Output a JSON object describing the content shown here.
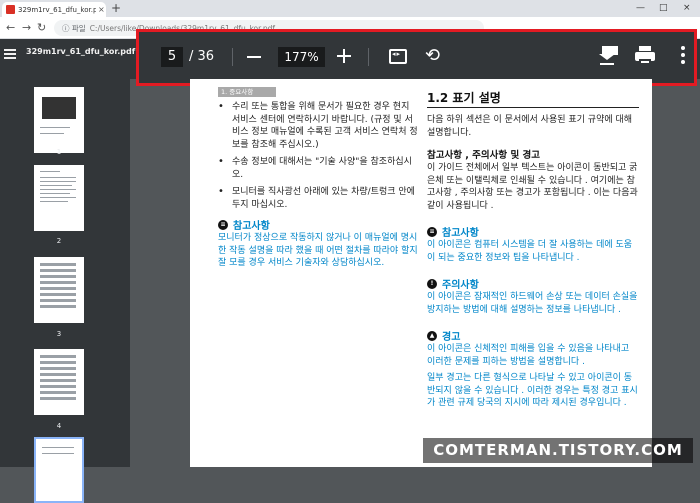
{
  "browser": {
    "tab_title": "329m1rv_61_dfu_kor.pdf",
    "tab_close": "×",
    "new_tab": "+",
    "win_min": "—",
    "win_max": "□",
    "win_close": "×",
    "back": "←",
    "forward": "→",
    "reload": "↻",
    "address_label": "ⓘ 파일",
    "address_path": "C:/Users/like/Downloads/329m1rv_61_dfu_kor.pdf"
  },
  "viewer": {
    "file_name": "329m1rv_61_dfu_kor.pdf",
    "page_current": "5",
    "page_total": "/ 36",
    "zoom": "177%",
    "rotate_icon": "⟲"
  },
  "sidebar": {
    "thumbnails": [
      {
        "label": "1"
      },
      {
        "label": "2"
      },
      {
        "label": "3"
      },
      {
        "label": "4"
      },
      {
        "label": "5"
      }
    ]
  },
  "document": {
    "left_header": "1. 중요사항",
    "left_bullets": [
      "수리 또는 통합을 위해 문서가 필요한 경우 현지 서비스 센터에 연락하시기 바랍니다. (규정 및 서비스 정보 매뉴얼에 수록된 고객 서비스 연락처 정보를 참조해 주십시오.)",
      "수송 정보에 대해서는 \"기술 사양\"을 참조하십시오.",
      "모니터를 직사광선 아래에 있는 차량/트렁크 안에 두지 마십시오."
    ],
    "left_note_title": "참고사항",
    "left_note_body": "모니터가 정상으로 작동하지 않거나 이 매뉴얼에 명시한 작동 설명을 따라 했을 때 어떤 절차를 따라야 할지 잘 모를 경우 서비스 기술자와 상담하십시오.",
    "right_title": "1.2  표기 설명",
    "right_intro": "다음 하위 섹션은 이 문서에서 사용된 표기 규약에 대해 설명합니다.",
    "right_sub": "참고사항 , 주의사항 및 경고",
    "right_sub_body": "이 가이드 전체에서 일부 텍스트는 아이콘이 동반되고 굵은체 또는 이탤릭체로 인쇄될 수 있습니다 . 여기에는 참고사항 , 주의사항 또는 경고가 포함됩니다 . 이는 다음과 같이 사용됩니다 .",
    "note_title": "참고사항",
    "note_body": "이 아이콘은 컴퓨터 시스템을 더 잘 사용하는 데에 도움이 되는 중요한 정보와 팁을 나타냅니다 .",
    "caution_title": "주의사항",
    "caution_body": "이 아이콘은 잠재적인 하드웨어 손상 또는 데이터 손실을 방지하는 방법에 대해 설명하는 정보를 나타냅니다 .",
    "warning_title": "경고",
    "warning_body": "이 아이콘은 신체적인 피해를 입을 수 있음을 나타내고 이러한 문제를 피하는 방법을 설명합니다 .",
    "warning_extra": "일부 경고는 다른 형식으로 나타날 수 있고 아이콘이 동반되지 않을 수 있습니다 . 이러한 경우는 특정 경고 표시가 관련 규제 당국의 지시에 따라 제시된 경우입니다 ."
  },
  "watermark": "COMTERMAN.TISTORY.COM"
}
